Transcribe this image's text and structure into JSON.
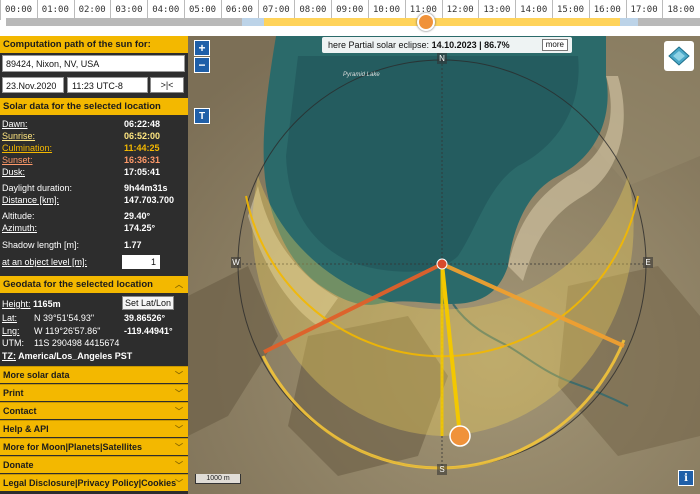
{
  "timeline": {
    "hours": [
      "00:00",
      "01:00",
      "02:00",
      "03:00",
      "04:00",
      "05:00",
      "06:00",
      "07:00",
      "08:00",
      "09:00",
      "10:00",
      "11:00",
      "12:00",
      "13:00",
      "14:00",
      "15:00",
      "16:00",
      "17:00",
      "18:00"
    ]
  },
  "panel": {
    "path_title": "Computation path of the sun for:",
    "address": "89424, Nixon, NV, USA",
    "date": "23.Nov.2020",
    "time": "11:23 UTC-8",
    "now_button": ">|<",
    "solar_title": "Solar data for the selected location",
    "dawn": {
      "label": "Dawn:",
      "value": "06:22:48"
    },
    "sunrise": {
      "label": "Sunrise:",
      "value": "06:52:00"
    },
    "culmination": {
      "label": "Culmination:",
      "value": "11:44:25"
    },
    "sunset": {
      "label": "Sunset:",
      "value": "16:36:31"
    },
    "dusk": {
      "label": "Dusk:",
      "value": "17:05:41"
    },
    "daylight": {
      "label": "Daylight duration:",
      "value": "9h44m31s"
    },
    "distance": {
      "label": "Distance [km]:",
      "value": "147.703.700"
    },
    "altitude": {
      "label": "Altitude:",
      "value": "29.40°"
    },
    "azimuth": {
      "label": "Azimuth:",
      "value": "174.25°"
    },
    "shadow": {
      "label": "Shadow length [m]:",
      "value": "1.77"
    },
    "object_level": {
      "label": "at an object level [m]:",
      "value": "1"
    },
    "geo_title": "Geodata for the selected location",
    "height": {
      "label": "Height:",
      "value": "1165m"
    },
    "set_latlon": "Set Lat/Lon",
    "lat": {
      "label": "Lat:",
      "dms": "N 39°51'54.93\"",
      "dec": "39.86526°"
    },
    "lng": {
      "label": "Lng:",
      "dms": "W 119°26'57.86\"",
      "dec": "-119.44941°"
    },
    "utm": {
      "label": "UTM:",
      "value": "11S 290498 4415674"
    },
    "tz": {
      "label": "TZ:",
      "value": "America/Los_Angeles  PST"
    }
  },
  "menu": {
    "more_solar": "More solar data",
    "print": "Print",
    "contact": "Contact",
    "help": "Help & API",
    "moon": "More for Moon|Planets|Satellites",
    "donate": "Donate",
    "legal": "Legal Disclosure|Privacy Policy|Cookies"
  },
  "map": {
    "eclipse_prefix": "here Partial solar eclipse:",
    "eclipse_value": "14.10.2023 | 86.7%",
    "more": "more",
    "scale": "1000 m",
    "lake_label": "Pyramid Lake",
    "compass": {
      "n": "N",
      "s": "S",
      "e": "E",
      "w": "W"
    },
    "zoom_in": "+",
    "zoom_out": "−",
    "t_button": "T",
    "info": "i"
  },
  "colors": {
    "accent": "#f3b800",
    "panel_bg": "#2d2d2d",
    "sunrise": "#ffe680",
    "sunset": "#ff9a6a",
    "culmination": "#f3b800",
    "sun_knob": "#f0923a"
  }
}
